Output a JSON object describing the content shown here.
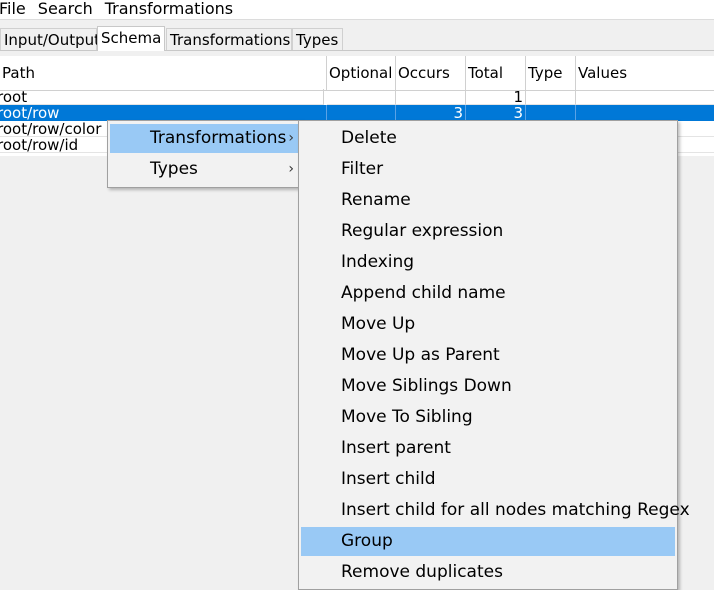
{
  "menubar": [
    "File",
    "Search",
    "Transformations"
  ],
  "tabs": [
    "Input/Output",
    "Schema",
    "Transformations",
    "Types"
  ],
  "active_tab": "Schema",
  "columns": [
    "Path",
    "Optional",
    "Occurs",
    "Total",
    "Type",
    "Values"
  ],
  "rows": [
    {
      "path": "root",
      "optional": "",
      "occurs": "",
      "total": "1",
      "type": "",
      "values": ""
    },
    {
      "path": "root/row",
      "optional": "",
      "occurs": "3",
      "total": "3",
      "type": "",
      "values": ""
    },
    {
      "path": "root/row/color",
      "optional": "",
      "occurs": "",
      "total": "",
      "type": "",
      "values": ""
    },
    {
      "path": "root/row/id",
      "optional": "",
      "occurs": "",
      "total": "",
      "type": "",
      "values": ""
    }
  ],
  "selected_row": "root/row",
  "context_menu": {
    "items": [
      "Transformations",
      "Types"
    ],
    "submenu_arrow": "›"
  },
  "transformations_submenu": {
    "items": [
      "Delete",
      "Filter",
      "Rename",
      "Regular expression",
      "Indexing",
      "Append child name",
      "Move Up",
      "Move Up as Parent",
      "Move Siblings Down",
      "Move To Sibling",
      "Insert parent",
      "Insert child",
      "Insert child for all nodes matching Regex",
      "Group",
      "Remove duplicates"
    ],
    "highlighted": "Group"
  },
  "colors": {
    "selection": "#0078d7",
    "menu_highlight": "#99c9f5"
  }
}
